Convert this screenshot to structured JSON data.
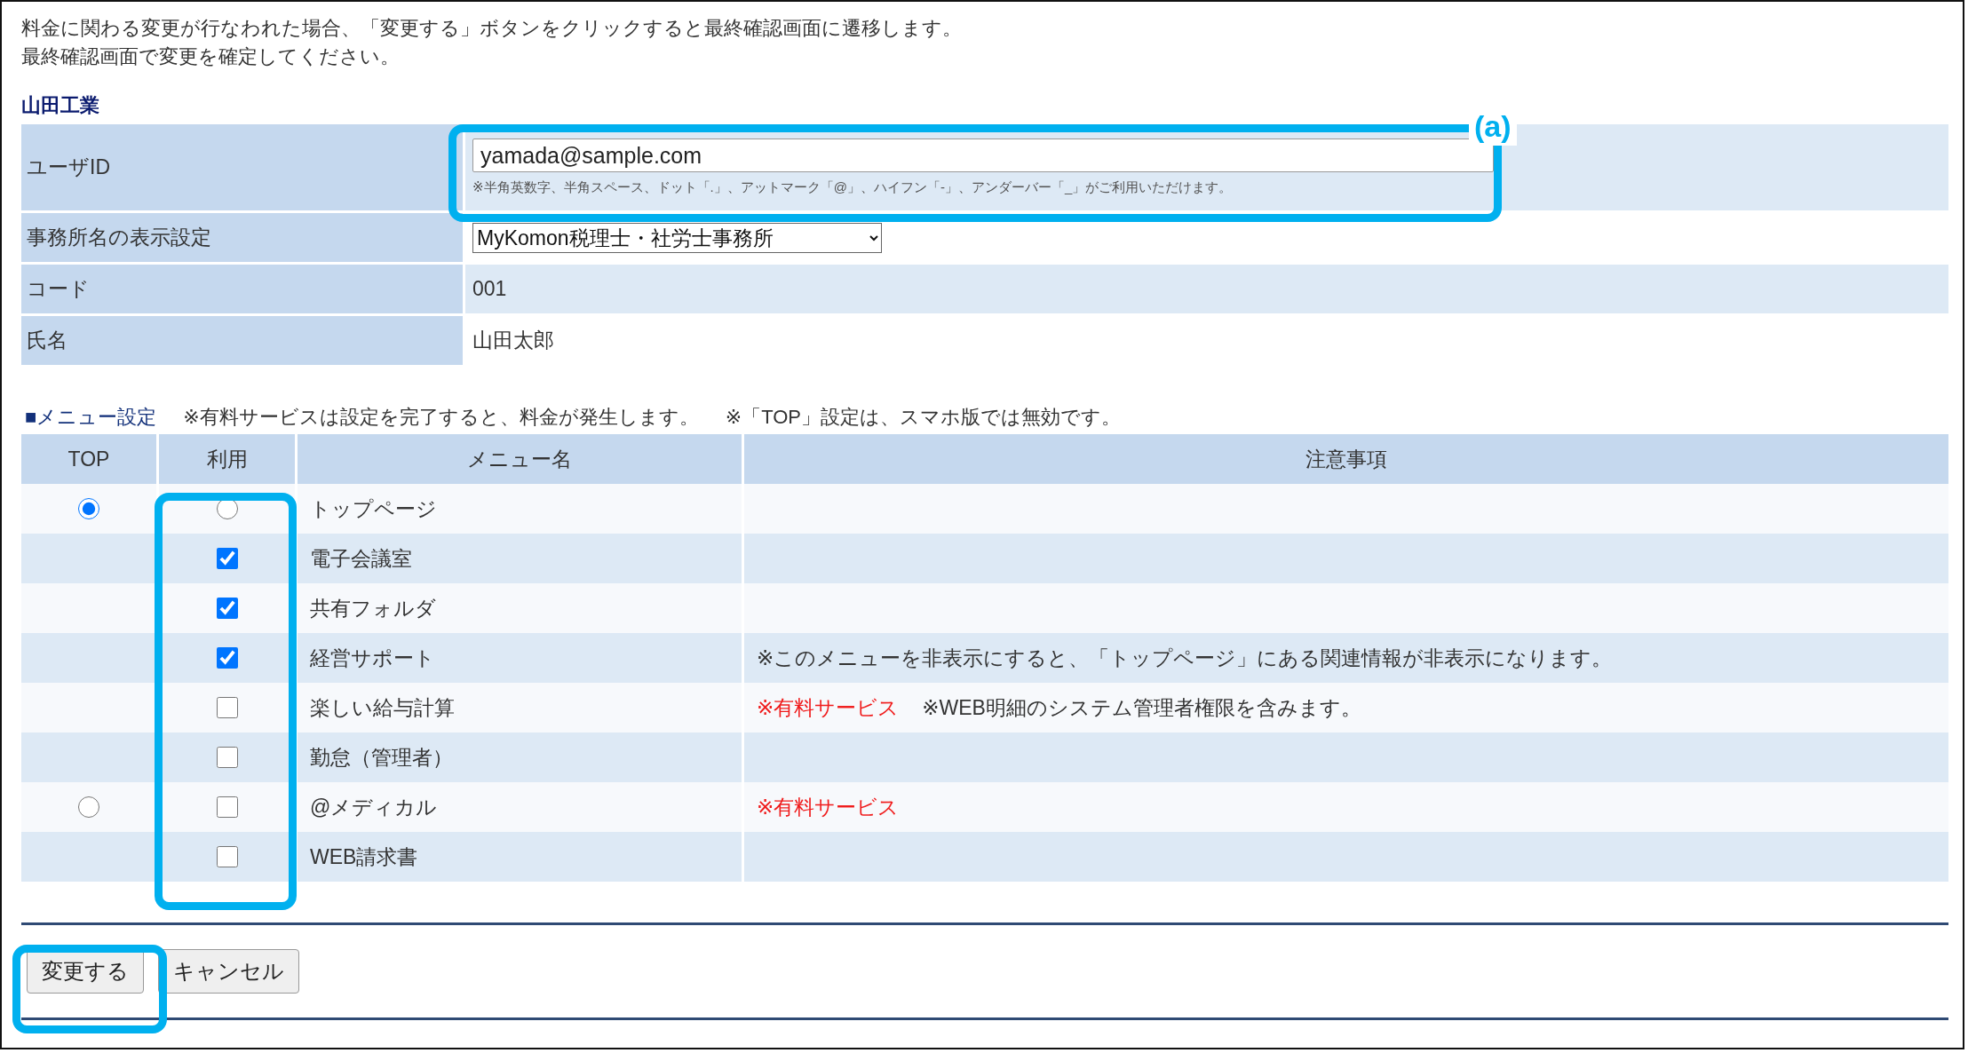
{
  "intro": [
    "料金に関わる変更が行なわれた場合、「変更する」ボタンをクリックすると最終確認画面に遷移します。",
    "最終確認画面で変更を確定してください。"
  ],
  "company": "山田工業",
  "user_form": {
    "user_id": {
      "label": "ユーザID",
      "value": "yamada@sample.com",
      "hint": "※半角英数字、半角スペース、ドット「.」、アットマーク「@」、ハイフン「-」、アンダーバー「_」がご利用いただけます。"
    },
    "office": {
      "label": "事務所名の表示設定",
      "value": "MyKomon税理士・社労士事務所"
    },
    "code": {
      "label": "コード",
      "value": "001"
    },
    "name": {
      "label": "氏名",
      "value": "山田太郎"
    }
  },
  "menu_settings": {
    "title": "■メニュー設定",
    "notes": [
      "※有料サービスは設定を完了すると、料金が発生します。",
      "※「TOP」設定は、スマホ版では無効です。"
    ]
  },
  "menu_table": {
    "columns": [
      "TOP",
      "利用",
      "メニュー名",
      "注意事項"
    ],
    "rows": [
      {
        "top": {
          "selected": true
        },
        "use": {
          "kind": "radio",
          "checked": false
        },
        "name": "トップページ",
        "notes": []
      },
      {
        "use": {
          "kind": "checkbox",
          "checked": true
        },
        "name": "電子会議室",
        "notes": []
      },
      {
        "use": {
          "kind": "checkbox",
          "checked": true
        },
        "name": "共有フォルダ",
        "notes": []
      },
      {
        "use": {
          "kind": "checkbox",
          "checked": true
        },
        "name": "経営サポート",
        "notes": [
          {
            "kind": "plain",
            "text": "※このメニューを非表示にすると、「トップページ」にある関連情報が非表示になります。"
          }
        ]
      },
      {
        "use": {
          "kind": "checkbox",
          "checked": false
        },
        "name": "楽しい給与計算",
        "notes": [
          {
            "kind": "warning",
            "text": "※有料サービス"
          },
          {
            "kind": "plain",
            "text": "※WEB明細のシステム管理者権限を含みます。"
          }
        ]
      },
      {
        "use": {
          "kind": "checkbox",
          "checked": false
        },
        "name": "勤怠（管理者）",
        "notes": []
      },
      {
        "top": {
          "selected": false
        },
        "use": {
          "kind": "checkbox",
          "checked": false
        },
        "name": "@メディカル",
        "notes": [
          {
            "kind": "warning",
            "text": "※有料サービス"
          }
        ]
      },
      {
        "use": {
          "kind": "checkbox",
          "checked": false
        },
        "name": "WEB請求書",
        "notes": []
      }
    ]
  },
  "buttons": [
    {
      "label": "変更する"
    },
    {
      "label": "キャンセル"
    }
  ],
  "annotation": {
    "label": "(a)"
  }
}
